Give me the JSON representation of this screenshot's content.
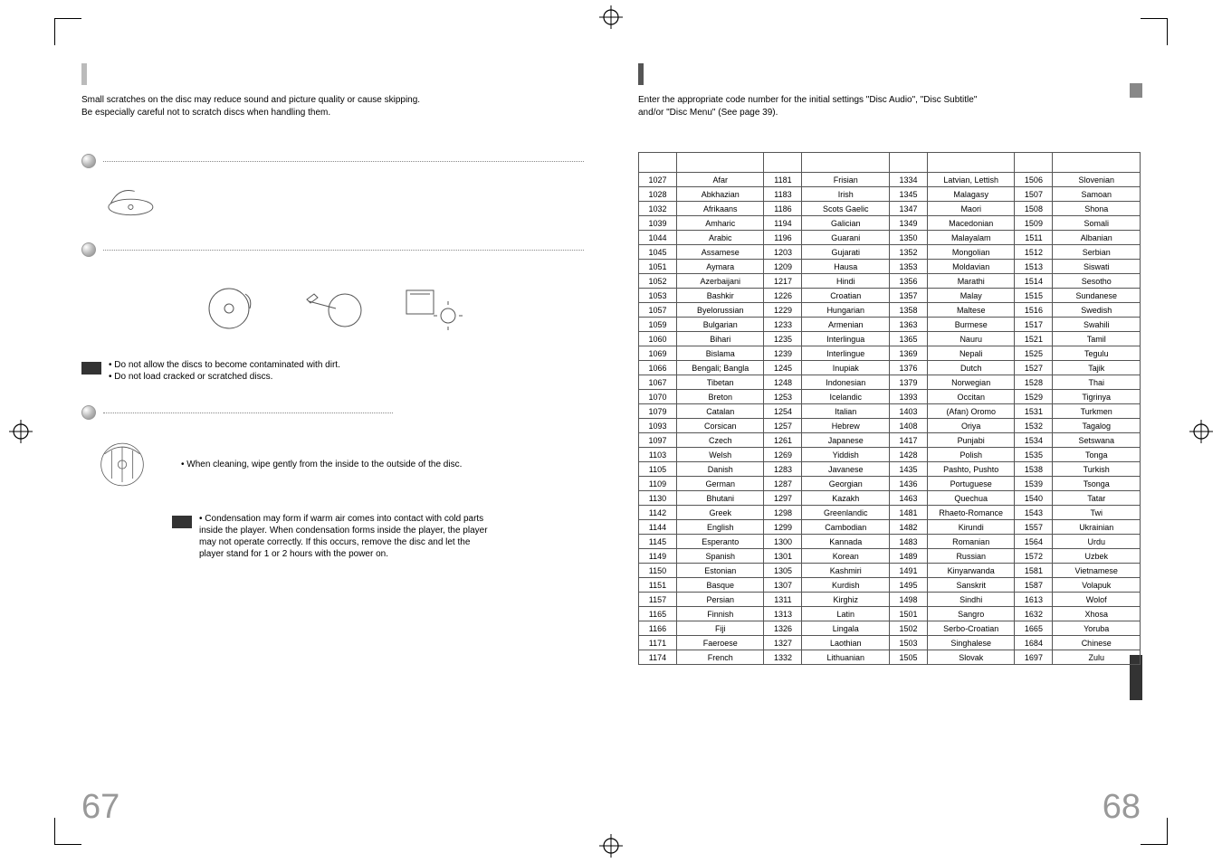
{
  "left": {
    "intro_l1": "Small scratches on the disc may reduce sound and picture quality or cause skipping.",
    "intro_l2": "Be especially careful not to scratch discs when handling them.",
    "notes_a": [
      "• Do not allow the discs to become contaminated with dirt.",
      "• Do not load cracked or scratched discs."
    ],
    "note_b": "• When cleaning, wipe gently from the inside to the outside of the disc.",
    "notes_c": [
      "• Condensation may form if warm air comes into contact with cold parts",
      "  inside the player. When condensation forms inside the player, the player",
      "  may not operate correctly. If this occurs, remove the disc and let the",
      "  player stand for 1 or 2 hours with the power on."
    ],
    "page": "67"
  },
  "right": {
    "intro_l1": "Enter the appropriate code number for the initial settings \"Disc Audio\", \"Disc Subtitle\"",
    "intro_l2": "and/or \"Disc Menu\" (See page 39).",
    "page": "68",
    "table": [
      [
        "1027",
        "Afar",
        "1181",
        "Frisian",
        "1334",
        "Latvian, Lettish",
        "1506",
        "Slovenian"
      ],
      [
        "1028",
        "Abkhazian",
        "1183",
        "Irish",
        "1345",
        "Malagasy",
        "1507",
        "Samoan"
      ],
      [
        "1032",
        "Afrikaans",
        "1186",
        "Scots Gaelic",
        "1347",
        "Maori",
        "1508",
        "Shona"
      ],
      [
        "1039",
        "Amharic",
        "1194",
        "Galician",
        "1349",
        "Macedonian",
        "1509",
        "Somali"
      ],
      [
        "1044",
        "Arabic",
        "1196",
        "Guarani",
        "1350",
        "Malayalam",
        "1511",
        "Albanian"
      ],
      [
        "1045",
        "Assamese",
        "1203",
        "Gujarati",
        "1352",
        "Mongolian",
        "1512",
        "Serbian"
      ],
      [
        "1051",
        "Aymara",
        "1209",
        "Hausa",
        "1353",
        "Moldavian",
        "1513",
        "Siswati"
      ],
      [
        "1052",
        "Azerbaijani",
        "1217",
        "Hindi",
        "1356",
        "Marathi",
        "1514",
        "Sesotho"
      ],
      [
        "1053",
        "Bashkir",
        "1226",
        "Croatian",
        "1357",
        "Malay",
        "1515",
        "Sundanese"
      ],
      [
        "1057",
        "Byelorussian",
        "1229",
        "Hungarian",
        "1358",
        "Maltese",
        "1516",
        "Swedish"
      ],
      [
        "1059",
        "Bulgarian",
        "1233",
        "Armenian",
        "1363",
        "Burmese",
        "1517",
        "Swahili"
      ],
      [
        "1060",
        "Bihari",
        "1235",
        "Interlingua",
        "1365",
        "Nauru",
        "1521",
        "Tamil"
      ],
      [
        "1069",
        "Bislama",
        "1239",
        "Interlingue",
        "1369",
        "Nepali",
        "1525",
        "Tegulu"
      ],
      [
        "1066",
        "Bengali; Bangla",
        "1245",
        "Inupiak",
        "1376",
        "Dutch",
        "1527",
        "Tajik"
      ],
      [
        "1067",
        "Tibetan",
        "1248",
        "Indonesian",
        "1379",
        "Norwegian",
        "1528",
        "Thai"
      ],
      [
        "1070",
        "Breton",
        "1253",
        "Icelandic",
        "1393",
        "Occitan",
        "1529",
        "Tigrinya"
      ],
      [
        "1079",
        "Catalan",
        "1254",
        "Italian",
        "1403",
        "(Afan) Oromo",
        "1531",
        "Turkmen"
      ],
      [
        "1093",
        "Corsican",
        "1257",
        "Hebrew",
        "1408",
        "Oriya",
        "1532",
        "Tagalog"
      ],
      [
        "1097",
        "Czech",
        "1261",
        "Japanese",
        "1417",
        "Punjabi",
        "1534",
        "Setswana"
      ],
      [
        "1103",
        "Welsh",
        "1269",
        "Yiddish",
        "1428",
        "Polish",
        "1535",
        "Tonga"
      ],
      [
        "1105",
        "Danish",
        "1283",
        "Javanese",
        "1435",
        "Pashto, Pushto",
        "1538",
        "Turkish"
      ],
      [
        "1109",
        "German",
        "1287",
        "Georgian",
        "1436",
        "Portuguese",
        "1539",
        "Tsonga"
      ],
      [
        "1130",
        "Bhutani",
        "1297",
        "Kazakh",
        "1463",
        "Quechua",
        "1540",
        "Tatar"
      ],
      [
        "1142",
        "Greek",
        "1298",
        "Greenlandic",
        "1481",
        "Rhaeto-Romance",
        "1543",
        "Twi"
      ],
      [
        "1144",
        "English",
        "1299",
        "Cambodian",
        "1482",
        "Kirundi",
        "1557",
        "Ukrainian"
      ],
      [
        "1145",
        "Esperanto",
        "1300",
        "Kannada",
        "1483",
        "Romanian",
        "1564",
        "Urdu"
      ],
      [
        "1149",
        "Spanish",
        "1301",
        "Korean",
        "1489",
        "Russian",
        "1572",
        "Uzbek"
      ],
      [
        "1150",
        "Estonian",
        "1305",
        "Kashmiri",
        "1491",
        "Kinyarwanda",
        "1581",
        "Vietnamese"
      ],
      [
        "1151",
        "Basque",
        "1307",
        "Kurdish",
        "1495",
        "Sanskrit",
        "1587",
        "Volapuk"
      ],
      [
        "1157",
        "Persian",
        "1311",
        "Kirghiz",
        "1498",
        "Sindhi",
        "1613",
        "Wolof"
      ],
      [
        "1165",
        "Finnish",
        "1313",
        "Latin",
        "1501",
        "Sangro",
        "1632",
        "Xhosa"
      ],
      [
        "1166",
        "Fiji",
        "1326",
        "Lingala",
        "1502",
        "Serbo-Croatian",
        "1665",
        "Yoruba"
      ],
      [
        "1171",
        "Faeroese",
        "1327",
        "Laothian",
        "1503",
        "Singhalese",
        "1684",
        "Chinese"
      ],
      [
        "1174",
        "French",
        "1332",
        "Lithuanian",
        "1505",
        "Slovak",
        "1697",
        "Zulu"
      ]
    ]
  }
}
